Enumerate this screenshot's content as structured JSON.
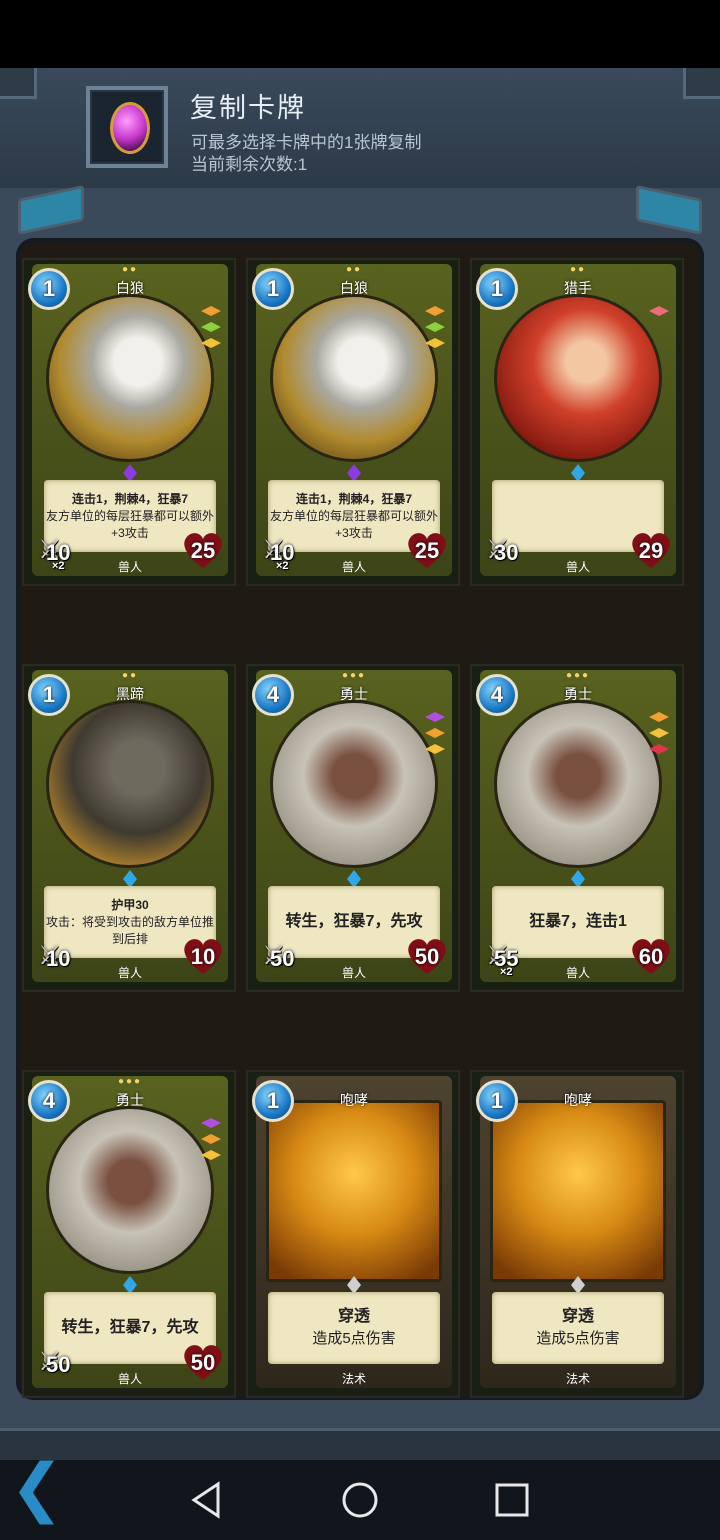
{
  "header": {
    "title": "复制卡牌",
    "subtitle": "可最多选择卡牌中的1张牌复制",
    "remaining": "当前剩余次数:1"
  },
  "cards": [
    {
      "name": "白狼",
      "cost": "1",
      "dots": "●●",
      "gems": [
        "#f0a030",
        "#8bd23c",
        "#f3c23a"
      ],
      "socket": "#8a3cdf",
      "lines": [
        {
          "t": "连击1，荆棘4，狂暴7",
          "cls": "b"
        },
        {
          "t": "友方单位的每层狂暴都可以额外+3攻击",
          "cls": ""
        }
      ],
      "atk": "10",
      "x2": "×2",
      "hp": "25",
      "race": "兽人",
      "portrait": "p-wolf"
    },
    {
      "name": "白狼",
      "cost": "1",
      "dots": "●●",
      "gems": [
        "#f0a030",
        "#8bd23c",
        "#f3c23a"
      ],
      "socket": "#8a3cdf",
      "lines": [
        {
          "t": "连击1，荆棘4，狂暴7",
          "cls": "b"
        },
        {
          "t": "友方单位的每层狂暴都可以额外+3攻击",
          "cls": ""
        }
      ],
      "atk": "10",
      "x2": "×2",
      "hp": "25",
      "race": "兽人",
      "portrait": "p-wolf"
    },
    {
      "name": "猎手",
      "cost": "1",
      "dots": "●●",
      "gems": [
        "#ef6c7a"
      ],
      "socket": "#31a8e6",
      "lines": [],
      "atk": "30",
      "x2": "",
      "hp": "29",
      "race": "兽人",
      "portrait": "p-hunt"
    },
    {
      "name": "黑蹄",
      "cost": "1",
      "dots": "●●",
      "gems": [],
      "socket": "#31a8e6",
      "lines": [
        {
          "t": "护甲30",
          "cls": "b"
        },
        {
          "t": "攻击：将受到攻击的敌方单位推到后排",
          "cls": ""
        }
      ],
      "atk": "10",
      "x2": "",
      "hp": "10",
      "race": "兽人",
      "portrait": "p-hoof"
    },
    {
      "name": "勇士",
      "cost": "4",
      "dots": "●●●",
      "gems": [
        "#b24ee0",
        "#f0a030",
        "#f3c23a"
      ],
      "socket": "#31a8e6",
      "lines": [
        {
          "t": "转生，狂暴7，先攻",
          "cls": "big"
        }
      ],
      "atk": "50",
      "x2": "",
      "hp": "50",
      "race": "兽人",
      "portrait": "p-war"
    },
    {
      "name": "勇士",
      "cost": "4",
      "dots": "●●●",
      "gems": [
        "#f0a030",
        "#f3c23a",
        "#e0364a"
      ],
      "socket": "#31a8e6",
      "lines": [
        {
          "t": "狂暴7，连击1",
          "cls": "big"
        }
      ],
      "atk": "55",
      "x2": "×2",
      "hp": "60",
      "race": "兽人",
      "portrait": "p-war"
    },
    {
      "name": "勇士",
      "cost": "4",
      "dots": "●●●",
      "gems": [
        "#b24ee0",
        "#f0a030",
        "#f3c23a"
      ],
      "socket": "#31a8e6",
      "lines": [
        {
          "t": "转生，狂暴7，先攻",
          "cls": "big"
        }
      ],
      "atk": "50",
      "x2": "",
      "hp": "50",
      "race": "兽人",
      "portrait": "p-war"
    },
    {
      "name": "咆哮",
      "cost": "1",
      "dots": "",
      "gems": [],
      "socket": "#cfcfcf",
      "spell": true,
      "lines": [
        {
          "t": "穿透",
          "cls": "big"
        },
        {
          "t": "造成5点伤害",
          "cls": "med"
        }
      ],
      "atk": "",
      "x2": "",
      "hp": "",
      "race": "法术",
      "portrait": ""
    },
    {
      "name": "咆哮",
      "cost": "1",
      "dots": "",
      "gems": [],
      "socket": "#cfcfcf",
      "spell": true,
      "lines": [
        {
          "t": "穿透",
          "cls": "big"
        },
        {
          "t": "造成5点伤害",
          "cls": "med"
        }
      ],
      "atk": "",
      "x2": "",
      "hp": "",
      "race": "法术",
      "portrait": ""
    }
  ],
  "icons": {
    "back": "back-arrow-icon",
    "nav_back": "triangle-back-icon",
    "nav_home": "circle-home-icon",
    "nav_recent": "square-recent-icon"
  },
  "colors": {
    "accent": "#2a8cc6",
    "frame": "#3b4a5a"
  }
}
